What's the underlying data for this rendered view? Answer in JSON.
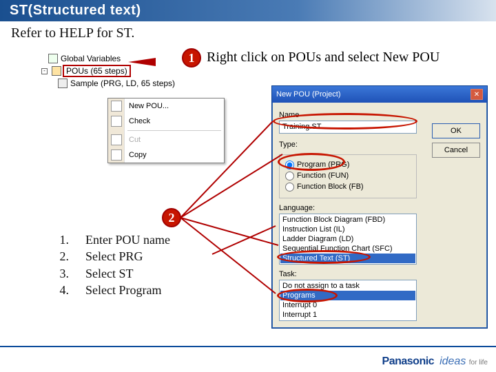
{
  "title": "ST(Structured text)",
  "subtitle": "Refer to HELP for ST.",
  "step1": {
    "num": "1",
    "text": "Right click on POUs and select New POU"
  },
  "tree": {
    "n1": "Global Variables",
    "n2": "POUs (65 steps)",
    "n3": "Sample (PRG, LD, 65 steps)"
  },
  "ctx": {
    "newpou": "New POU...",
    "check": "Check",
    "cut": "Cut",
    "copy": "Copy"
  },
  "step2": {
    "num": "2"
  },
  "instr": {
    "i1n": "1.",
    "i1t": "Enter POU name",
    "i2n": "2.",
    "i2t": "Select PRG",
    "i3n": "3.",
    "i3t": "Select ST",
    "i4n": "4.",
    "i4t": "Select Program"
  },
  "dlg": {
    "title": "New POU (Project)",
    "name_label": "Name",
    "name_value": "Training.ST",
    "type_label": "Type:",
    "r1": "Program (PRG)",
    "r2": "Function (FUN)",
    "r3": "Function Block (FB)",
    "lang_label": "Language:",
    "lang1": "Function Block Diagram (FBD)",
    "lang2": "Instruction List (IL)",
    "lang3": "Ladder Diagram (LD)",
    "lang4": "Sequential Function Chart (SFC)",
    "lang5": "Structured Text (ST)",
    "task_label": "Task:",
    "task0": "Do not assign to a task",
    "task1": "Programs",
    "task2": "Interrupt 0",
    "task3": "Interrupt 1",
    "ok": "OK",
    "cancel": "Cancel"
  },
  "brand": {
    "name": "Panasonic",
    "slogan": "ideas",
    "slogan2": "for life"
  }
}
